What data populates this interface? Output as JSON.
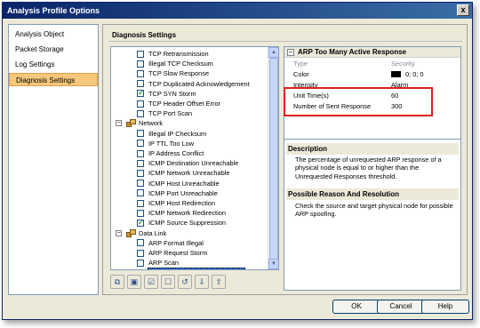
{
  "window": {
    "title": "Analysis Profile Options",
    "close_glyph": "x"
  },
  "nav": {
    "items": [
      {
        "label": "Analysis Object"
      },
      {
        "label": "Packet Storage"
      },
      {
        "label": "Log Settings"
      },
      {
        "label": "Diagnosis Settings",
        "active": true
      }
    ]
  },
  "section": {
    "title": "Diagnosis Settings"
  },
  "tree": {
    "rows": [
      {
        "label": "TCP Retransmission",
        "checked": false,
        "level": 2
      },
      {
        "label": "Illegal TCP Checksum",
        "checked": false,
        "level": 2
      },
      {
        "label": "TCP Slow Response",
        "checked": false,
        "level": 2
      },
      {
        "label": "TCP Duplicated Acknowledgement",
        "checked": false,
        "level": 2
      },
      {
        "label": "TCP SYN Storm",
        "checked": true,
        "level": 2
      },
      {
        "label": "TCP Header Offset Error",
        "checked": false,
        "level": 2
      },
      {
        "label": "TCP Port Scan",
        "checked": false,
        "level": 2
      },
      {
        "label": "Network",
        "group": true,
        "level": 1
      },
      {
        "label": "Illegal IP Checksum",
        "checked": false,
        "level": 2
      },
      {
        "label": "IP TTL Too Low",
        "checked": false,
        "level": 2
      },
      {
        "label": "IP Address Conflict",
        "checked": false,
        "level": 2
      },
      {
        "label": "ICMP Destination Unreachable",
        "checked": false,
        "level": 2
      },
      {
        "label": "ICMP Network Unreachable",
        "checked": false,
        "level": 2
      },
      {
        "label": "ICMP Host Unreachable",
        "checked": false,
        "level": 2
      },
      {
        "label": "ICMP Port Unreachable",
        "checked": false,
        "level": 2
      },
      {
        "label": "ICMP Host Redirection",
        "checked": false,
        "level": 2
      },
      {
        "label": "ICMP Network Redirection",
        "checked": false,
        "level": 2
      },
      {
        "label": "ICMP Source Suppression",
        "checked": true,
        "level": 2
      },
      {
        "label": "Data Link",
        "group": true,
        "level": 1
      },
      {
        "label": "ARP Format Illegal",
        "checked": false,
        "level": 2
      },
      {
        "label": "ARP Request Storm",
        "checked": false,
        "level": 2
      },
      {
        "label": "ARP Scan",
        "checked": false,
        "level": 2
      },
      {
        "label": "ARP Too Many Active Response",
        "checked": true,
        "level": 2,
        "selected": true
      }
    ],
    "expander_glyph": "−"
  },
  "toolbar": {
    "buttons": [
      {
        "icon": "expand-all-icon",
        "glyph": "⧉"
      },
      {
        "icon": "collapse-all-icon",
        "glyph": "▣"
      },
      {
        "icon": "check-all-icon",
        "glyph": "☑"
      },
      {
        "icon": "uncheck-all-icon",
        "glyph": "☐"
      },
      {
        "icon": "restore-default-icon",
        "glyph": "↺"
      },
      {
        "icon": "import-icon",
        "glyph": "⇩"
      },
      {
        "icon": "export-icon",
        "glyph": "⇧"
      }
    ]
  },
  "properties": {
    "title": "ARP Too Many Active Response",
    "collapse_glyph": "−",
    "rows": [
      {
        "name": "Type",
        "value": "Security",
        "dim": true
      },
      {
        "name": "Color",
        "value": "0; 0; 0",
        "swatch": "#000000"
      },
      {
        "name": "Intensity",
        "value": "Alarm"
      },
      {
        "name": "Unit Time(s)",
        "value": "60"
      },
      {
        "name": "Number of Sent Response",
        "value": "300"
      }
    ]
  },
  "description": {
    "heading": "Description",
    "text": "The percentage of unrequested ARP response of a physical node is equal to or higher than the Unrequested Responses threshold.",
    "reason_heading": "Possible Reason And Resolution",
    "reason_text": "Check the source and target physical node for possible ARP spoofing."
  },
  "buttons": {
    "ok": "OK",
    "cancel": "Cancel",
    "help": "Help"
  },
  "scrollbar": {
    "up_glyph": "▲",
    "down_glyph": "▼"
  },
  "colors": {
    "highlight": "#e02020",
    "selection": "#316ac5",
    "active_nav": "#f7c87b"
  }
}
